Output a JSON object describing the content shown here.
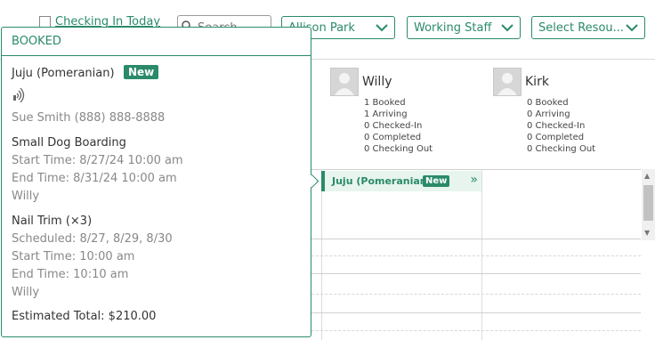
{
  "toolbar": {
    "checking_in_label": "Checking In Today",
    "search_placeholder": "Search...",
    "location": "Allison Park",
    "staff_filter": "Working Staff",
    "resource_filter": "Select Resou..."
  },
  "staff": [
    {
      "name": "Willy",
      "stats": [
        "1 Booked",
        "1 Arriving",
        "0 Checked-In",
        "0 Completed",
        "0 Checking Out"
      ]
    },
    {
      "name": "Kirk",
      "stats": [
        "0 Booked",
        "0 Arriving",
        "0 Checked-In",
        "0 Completed",
        "0 Checking Out"
      ]
    }
  ],
  "appointment": {
    "name": "Juju (Pomeranian)",
    "badge": "New",
    "arrow": "»"
  },
  "popover": {
    "status": "BOOKED",
    "pet_name": "Juju (Pomeranian)",
    "badge": "New",
    "owner": "Sue Smith  (888) 888-8888",
    "service1": {
      "title": "Small Dog Boarding",
      "start": "Start Time: 8/27/24 10:00 am",
      "end": "End Time: 8/31/24 10:00 am",
      "staff": "Willy"
    },
    "service2": {
      "title": "Nail Trim (×3)",
      "scheduled": "Scheduled: 8/27, 8/29, 8/30",
      "start": "Start Time: 10:00 am",
      "end": "End Time: 10:10 am",
      "staff": "Willy"
    },
    "total": "Estimated Total: $210.00"
  },
  "colors": {
    "accent": "#2a8a6a",
    "muted": "#888888"
  },
  "icons": [
    "search-icon",
    "chevron-down-icon",
    "pet-wave-icon",
    "avatar-icon",
    "double-chevron-right-icon"
  ]
}
